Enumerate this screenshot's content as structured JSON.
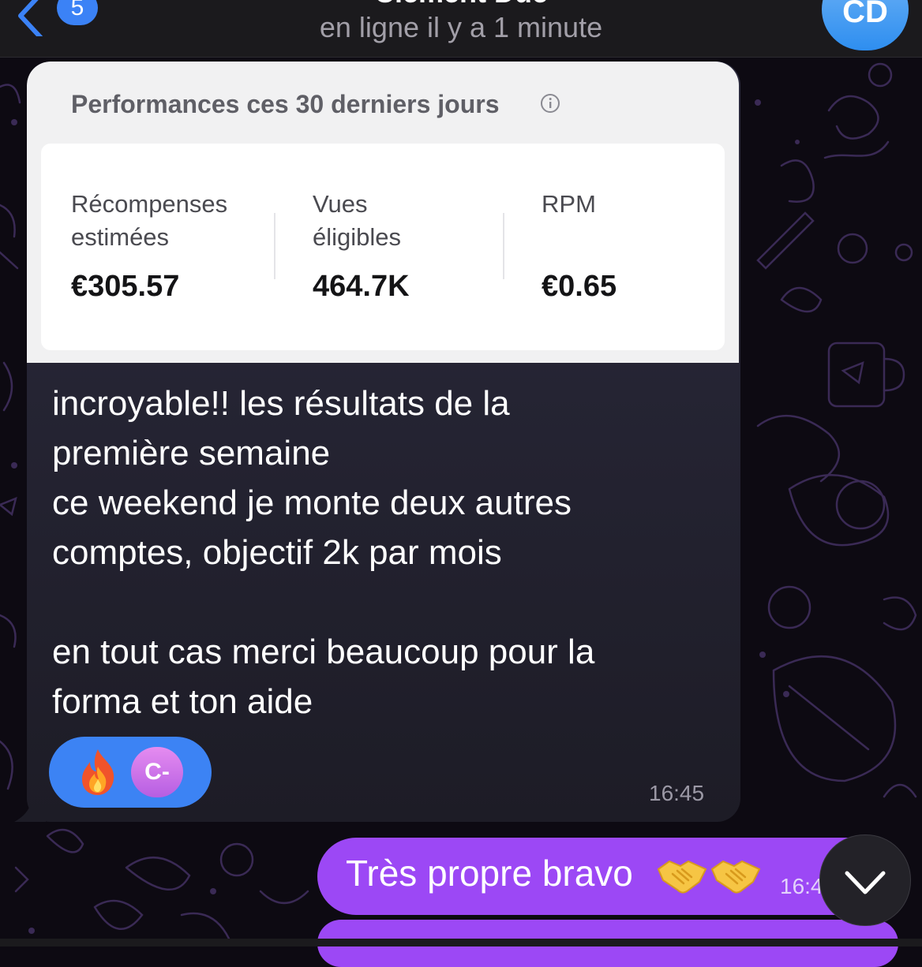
{
  "header": {
    "back_badge": "5",
    "contact_name": "Clément Duc",
    "status": "en ligne il y a 1 minute",
    "avatar_initials": "CD"
  },
  "colors": {
    "accent_blue": "#3b82f6",
    "outgoing_bubble": "#9c48f5",
    "incoming_bubble": "#2b2a3d"
  },
  "incoming_message": {
    "card": {
      "title": "Performances ces 30 derniers jours",
      "stats": [
        {
          "label": "Récompenses\nestimées",
          "value": "€305.57"
        },
        {
          "label": "Vues\néligibles",
          "value": "464.7K"
        },
        {
          "label": "RPM",
          "value": "€0.65"
        }
      ]
    },
    "text": "incroyable!! les résultats de la\npremière semaine\nce weekend je monte deux autres\ncomptes, objectif 2k par mois\n\nen tout cas merci beaucoup pour la\nforma et ton aide",
    "reaction": {
      "emoji_icon": "fire-icon",
      "avatar_initials": "C-"
    },
    "time": "16:45"
  },
  "outgoing_message": {
    "text": "Très propre bravo",
    "emoji_icons": [
      "handshake-icon",
      "handshake-icon"
    ],
    "time": "16:4"
  }
}
